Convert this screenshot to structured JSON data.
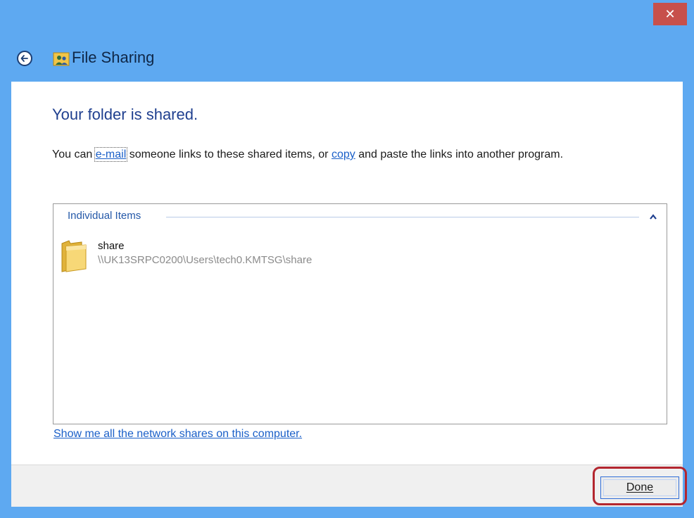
{
  "window": {
    "title": "File Sharing",
    "close_label": "✕"
  },
  "main": {
    "heading": "Your folder is shared.",
    "description": {
      "prefix": "You can ",
      "email_link": "e-mail",
      "middle": " someone links to these shared items, or ",
      "copy_link": "copy",
      "suffix": " and paste the links into another program."
    },
    "items_group": {
      "label": "Individual Items",
      "items": [
        {
          "name": "share",
          "path": "\\\\UK13SRPC0200\\Users\\tech0.KMTSG\\share"
        }
      ]
    },
    "show_shares_link": "Show me all the network shares on this computer."
  },
  "footer": {
    "done_label": "Done"
  },
  "colors": {
    "title_bar": "#5ea9f1",
    "close_button": "#c7504b",
    "heading_text": "#1f3f8f",
    "link": "#1a5fc8",
    "highlight_border": "#b3262f"
  },
  "icons": {
    "back": "back-arrow-icon",
    "app": "file-sharing-icon",
    "folder": "folder-icon",
    "collapse": "chevron-up-icon"
  }
}
